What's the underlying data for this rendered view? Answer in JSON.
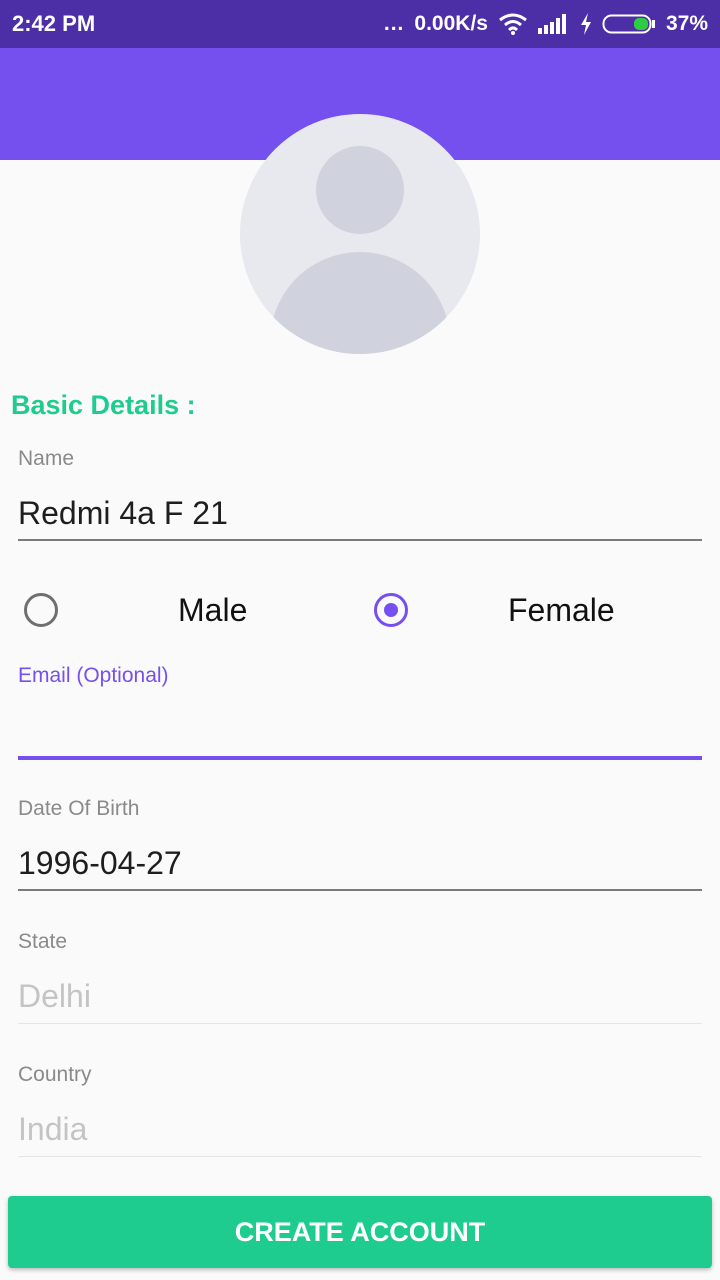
{
  "status_bar": {
    "time": "2:42 PM",
    "more_glyph": "...",
    "net_speed": "0.00K/s",
    "battery": "37%",
    "icons": [
      "more-dots-icon",
      "wifi-icon",
      "signal-icon",
      "charging-bolt-icon",
      "battery-icon"
    ]
  },
  "colors": {
    "status_bar": "#4c2fa6",
    "toolbar": "#7650ef",
    "accent": "#7650ef",
    "section_title": "#1fcc8f",
    "button": "#1fcc8f"
  },
  "section_title": "Basic Details :",
  "fields": {
    "name": {
      "label": "Name",
      "value": "Redmi 4a F 21"
    },
    "email": {
      "label": "Email (Optional)",
      "value": ""
    },
    "dob": {
      "label": "Date Of Birth",
      "value": "1996-04-27"
    },
    "state": {
      "label": "State",
      "value": "Delhi"
    },
    "country": {
      "label": "Country",
      "value": "India"
    }
  },
  "gender": {
    "options": [
      {
        "label": "Male",
        "checked": false
      },
      {
        "label": "Female",
        "checked": true
      }
    ]
  },
  "create_button_label": "CREATE ACCOUNT"
}
